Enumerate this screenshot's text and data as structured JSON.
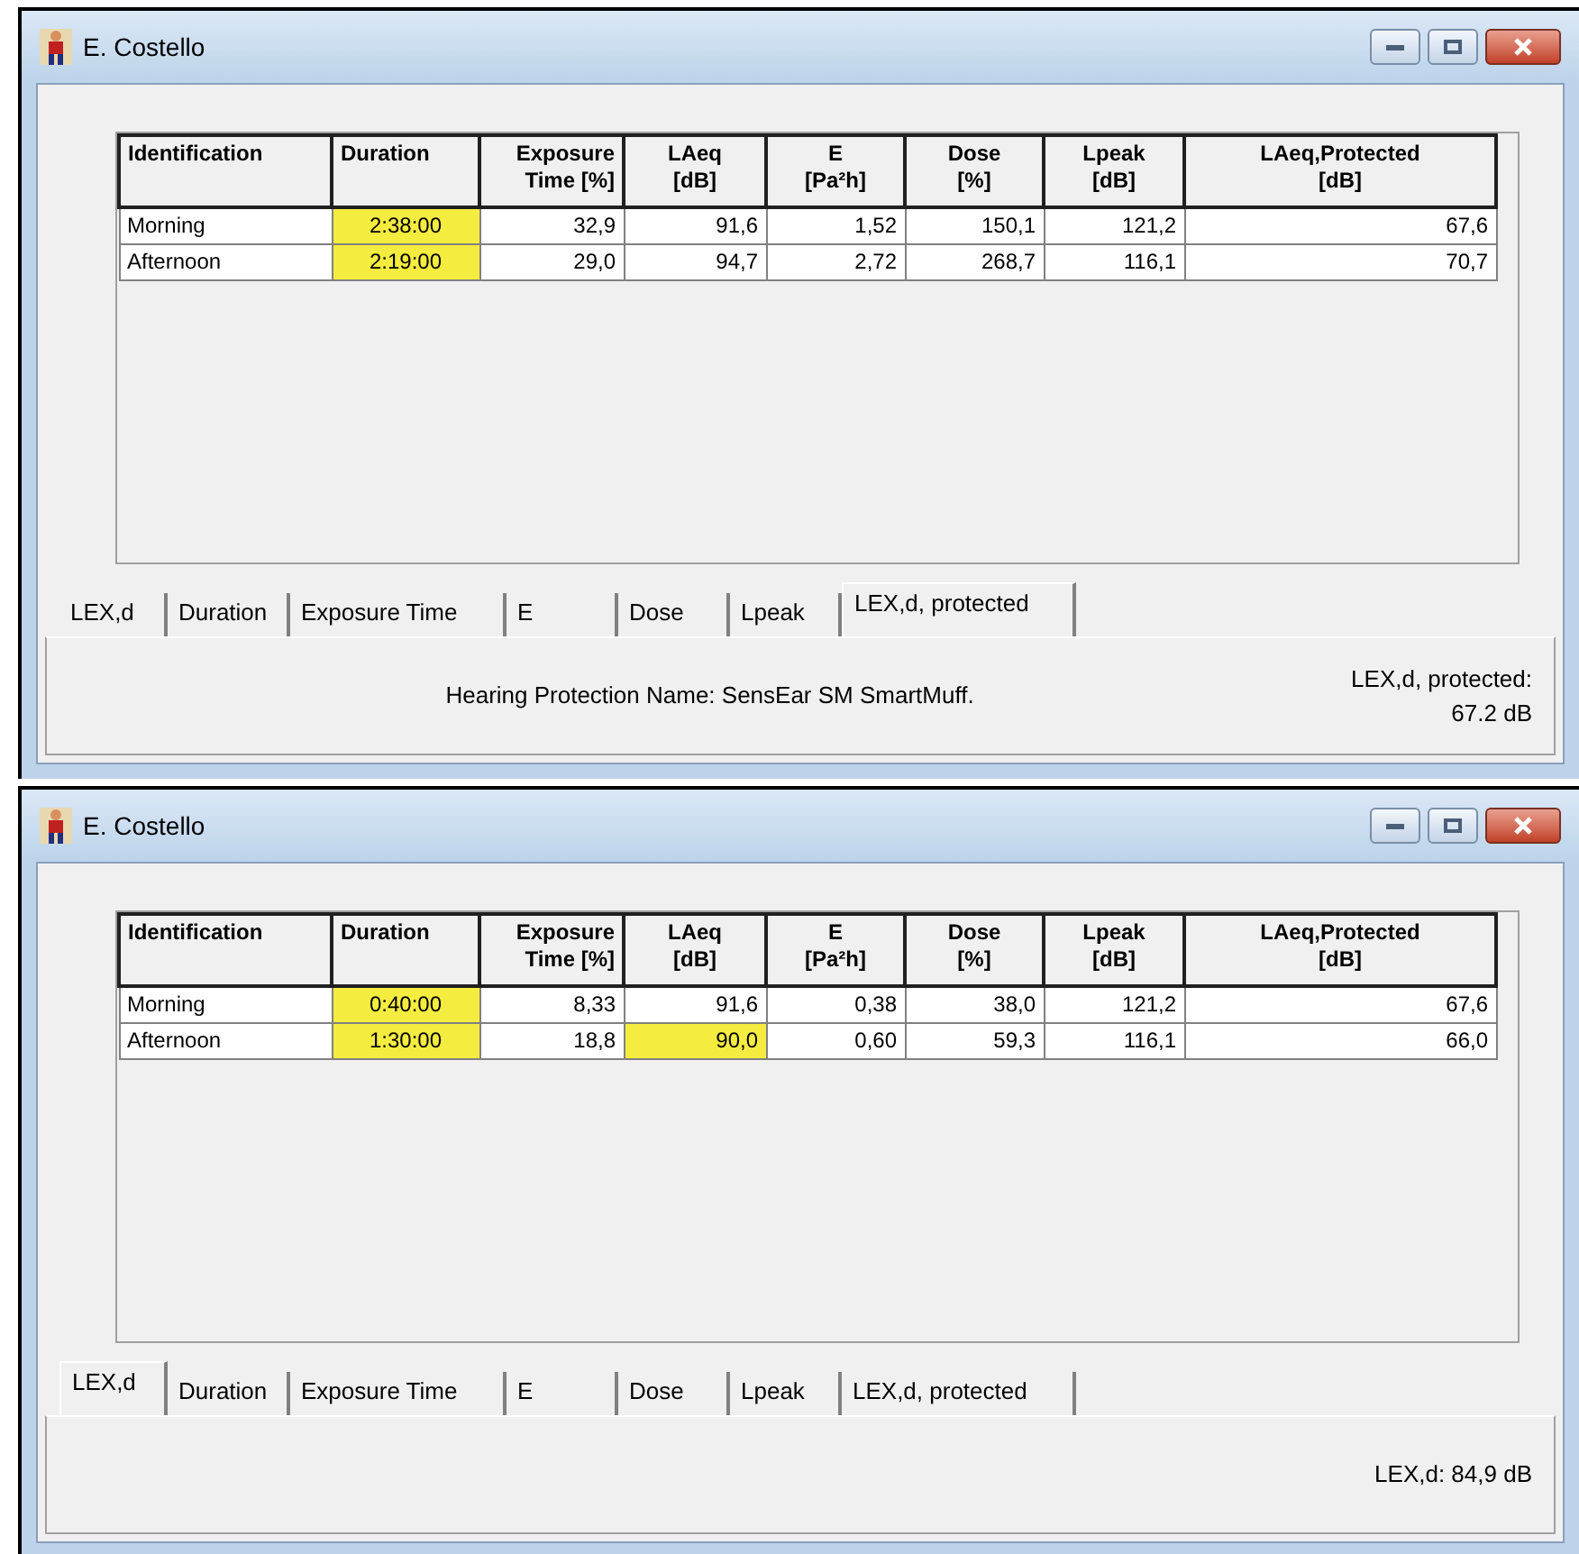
{
  "windows": [
    {
      "title": "E. Costello",
      "table": {
        "columns": [
          {
            "lines": [
              "Identification"
            ]
          },
          {
            "lines": [
              "Duration"
            ]
          },
          {
            "lines": [
              "Exposure",
              "Time [%]"
            ]
          },
          {
            "lines": [
              "LAeq",
              "[dB]"
            ]
          },
          {
            "lines": [
              "E",
              "[Pa²h]"
            ]
          },
          {
            "lines": [
              "Dose",
              "[%]"
            ]
          },
          {
            "lines": [
              "Lpeak",
              "[dB]"
            ]
          },
          {
            "lines": [
              "LAeq,Protected",
              "[dB]"
            ]
          }
        ],
        "rows": [
          [
            {
              "text": "Morning",
              "highlighted": false
            },
            {
              "text": "2:38:00",
              "highlighted": true
            },
            {
              "text": "32,9",
              "highlighted": false
            },
            {
              "text": "91,6",
              "highlighted": false
            },
            {
              "text": "1,52",
              "highlighted": false
            },
            {
              "text": "150,1",
              "highlighted": false
            },
            {
              "text": "121,2",
              "highlighted": false
            },
            {
              "text": "67,6",
              "highlighted": false
            }
          ],
          [
            {
              "text": "Afternoon",
              "highlighted": false
            },
            {
              "text": "2:19:00",
              "highlighted": true
            },
            {
              "text": "29,0",
              "highlighted": false
            },
            {
              "text": "94,7",
              "highlighted": false
            },
            {
              "text": "2,72",
              "highlighted": false
            },
            {
              "text": "268,7",
              "highlighted": false
            },
            {
              "text": "116,1",
              "highlighted": false
            },
            {
              "text": "70,7",
              "highlighted": false
            }
          ]
        ]
      },
      "tabs": [
        {
          "label": "LEX,d",
          "selected": false
        },
        {
          "label": "Duration",
          "selected": false
        },
        {
          "label": "Exposure Time",
          "selected": false
        },
        {
          "label": "E",
          "selected": false
        },
        {
          "label": "Dose",
          "selected": false
        },
        {
          "label": "Lpeak",
          "selected": false
        },
        {
          "label": "LEX,d, protected",
          "selected": true
        }
      ],
      "protection_name": "Hearing Protection Name: SensEar SM SmartMuff.",
      "result_lines": [
        "LEX,d, protected:",
        "67.2 dB"
      ]
    },
    {
      "title": "E. Costello",
      "table": {
        "columns": [
          {
            "lines": [
              "Identification"
            ]
          },
          {
            "lines": [
              "Duration"
            ]
          },
          {
            "lines": [
              "Exposure",
              "Time [%]"
            ]
          },
          {
            "lines": [
              "LAeq",
              "[dB]"
            ]
          },
          {
            "lines": [
              "E",
              "[Pa²h]"
            ]
          },
          {
            "lines": [
              "Dose",
              "[%]"
            ]
          },
          {
            "lines": [
              "Lpeak",
              "[dB]"
            ]
          },
          {
            "lines": [
              "LAeq,Protected",
              "[dB]"
            ]
          }
        ],
        "rows": [
          [
            {
              "text": "Morning",
              "highlighted": false
            },
            {
              "text": "0:40:00",
              "highlighted": true
            },
            {
              "text": "8,33",
              "highlighted": false
            },
            {
              "text": "91,6",
              "highlighted": false
            },
            {
              "text": "0,38",
              "highlighted": false
            },
            {
              "text": "38,0",
              "highlighted": false
            },
            {
              "text": "121,2",
              "highlighted": false
            },
            {
              "text": "67,6",
              "highlighted": false
            }
          ],
          [
            {
              "text": "Afternoon",
              "highlighted": false
            },
            {
              "text": "1:30:00",
              "highlighted": true
            },
            {
              "text": "18,8",
              "highlighted": false
            },
            {
              "text": "90,0",
              "highlighted": true
            },
            {
              "text": "0,60",
              "highlighted": false
            },
            {
              "text": "59,3",
              "highlighted": false
            },
            {
              "text": "116,1",
              "highlighted": false
            },
            {
              "text": "66,0",
              "highlighted": false
            }
          ]
        ]
      },
      "tabs": [
        {
          "label": "LEX,d",
          "selected": true
        },
        {
          "label": "Duration",
          "selected": false
        },
        {
          "label": "Exposure Time",
          "selected": false
        },
        {
          "label": "E",
          "selected": false
        },
        {
          "label": "Dose",
          "selected": false
        },
        {
          "label": "Lpeak",
          "selected": false
        },
        {
          "label": "LEX,d, protected",
          "selected": false
        }
      ],
      "result_lines": [
        "LEX,d: 84,9 dB"
      ]
    }
  ]
}
